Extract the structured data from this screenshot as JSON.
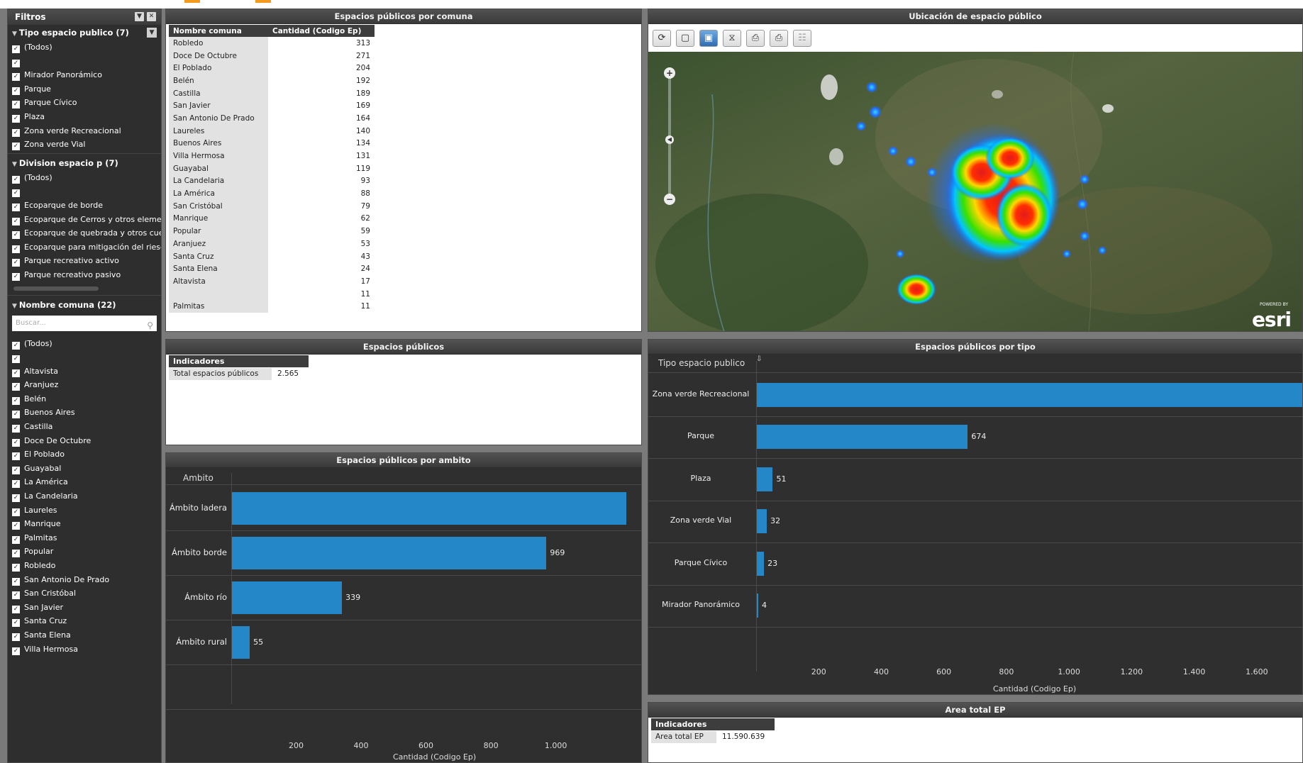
{
  "filters": {
    "title": "Filtros",
    "tipo_section": "Tipo espacio publico (7)",
    "tipo_items": [
      "(Todos)",
      "",
      "Mirador Panorámico",
      "Parque",
      "Parque Cívico",
      "Plaza",
      "Zona verde Recreacional",
      "Zona verde Vial"
    ],
    "division_section": "Division espacio p (7)",
    "division_items": [
      "(Todos)",
      "",
      "Ecoparque de borde",
      "Ecoparque de Cerros y otros elemer",
      "Ecoparque de quebrada y otros cue",
      "Ecoparque para mitigación del riesg",
      "Parque recreativo activo",
      "Parque recreativo pasivo"
    ],
    "comuna_section": "Nombre comuna (22)",
    "search_placeholder": "Buscar...",
    "comuna_items": [
      "(Todos)",
      "",
      "Altavista",
      "Aranjuez",
      "Belén",
      "Buenos Aires",
      "Castilla",
      "Doce De Octubre",
      "El Poblado",
      "Guayabal",
      "La América",
      "La Candelaria",
      "Laureles",
      "Manrique",
      "Palmitas",
      "Popular",
      "Robledo",
      "San Antonio De Prado",
      "San Cristóbal",
      "San Javier",
      "Santa Cruz",
      "Santa Elena",
      "Villa Hermosa"
    ]
  },
  "comuna_panel": {
    "title": "Espacios públicos por comuna",
    "col1": "Nombre comuna",
    "col2": "Cantidad (Codigo Ep)",
    "rows": [
      [
        "Robledo",
        "313"
      ],
      [
        "Doce De Octubre",
        "271"
      ],
      [
        "El Poblado",
        "204"
      ],
      [
        "Belén",
        "192"
      ],
      [
        "Castilla",
        "189"
      ],
      [
        "San Javier",
        "169"
      ],
      [
        "San Antonio De Prado",
        "164"
      ],
      [
        "Laureles",
        "140"
      ],
      [
        "Buenos Aires",
        "134"
      ],
      [
        "Villa Hermosa",
        "131"
      ],
      [
        "Guayabal",
        "119"
      ],
      [
        "La Candelaria",
        "93"
      ],
      [
        "La América",
        "88"
      ],
      [
        "San Cristóbal",
        "79"
      ],
      [
        "Manrique",
        "62"
      ],
      [
        "Popular",
        "59"
      ],
      [
        "Aranjuez",
        "53"
      ],
      [
        "Santa Cruz",
        "43"
      ],
      [
        "Santa Elena",
        "24"
      ],
      [
        "Altavista",
        "17"
      ],
      [
        "",
        "11"
      ],
      [
        "Palmitas",
        "11"
      ]
    ]
  },
  "map_panel": {
    "title": "Ubicación de espacio público",
    "tools": [
      "refresh-icon",
      "select-rectangle-icon",
      "save-icon",
      "filter-icon",
      "print-icon",
      "print-preview-icon",
      "table-icon"
    ],
    "logo": "esri",
    "logo_small": "POWERED BY"
  },
  "espacios_panel": {
    "title": "Espacios públicos",
    "header": "Indicadores",
    "label": "Total espacios públicos",
    "value": "2.565"
  },
  "ambito_panel": {
    "title": "Espacios públicos por ambito",
    "axis_title": "Ambito",
    "xlabel": "Cantidad (Codigo Ep)",
    "ticks": [
      "200",
      "400",
      "600",
      "800",
      "1.000"
    ]
  },
  "tipo_panel": {
    "title": "Espacios públicos por tipo",
    "axis_title": "Tipo espacio publico",
    "xlabel": "Cantidad (Codigo Ep)",
    "ticks": [
      "200",
      "400",
      "600",
      "800",
      "1.000",
      "1.200",
      "1.400",
      "1.600"
    ]
  },
  "area_panel": {
    "title": "Area total EP",
    "header": "Indicadores",
    "label": "Area total EP",
    "value": "11.590.639"
  },
  "chart_data": [
    {
      "type": "bar",
      "title": "Espacios públicos por ambito",
      "xlabel": "Cantidad (Codigo Ep)",
      "ylabel": "Ambito",
      "categories": [
        "Ámbito ladera",
        "Ámbito borde",
        "Ámbito río",
        "Ámbito rural"
      ],
      "values": [
        1215,
        969,
        339,
        55
      ],
      "labels": [
        "",
        "969",
        "339",
        "55"
      ],
      "xlim": [
        0,
        1250
      ]
    },
    {
      "type": "bar",
      "title": "Espacios públicos por tipo",
      "xlabel": "Cantidad (Codigo Ep)",
      "ylabel": "Tipo espacio publico",
      "categories": [
        "Zona verde Recreacional",
        "Parque",
        "Plaza",
        "Zona verde Vial",
        "Parque Cívico",
        "Mirador Panorámico"
      ],
      "values": [
        1781,
        674,
        51,
        32,
        23,
        4
      ],
      "labels": [
        "",
        "674",
        "51",
        "32",
        "23",
        "4"
      ],
      "xlim": [
        0,
        1750
      ]
    }
  ],
  "colors": {
    "bar": "#2487c8",
    "panel_dark": "#2f2f2f",
    "header": "#3d3d3d"
  }
}
